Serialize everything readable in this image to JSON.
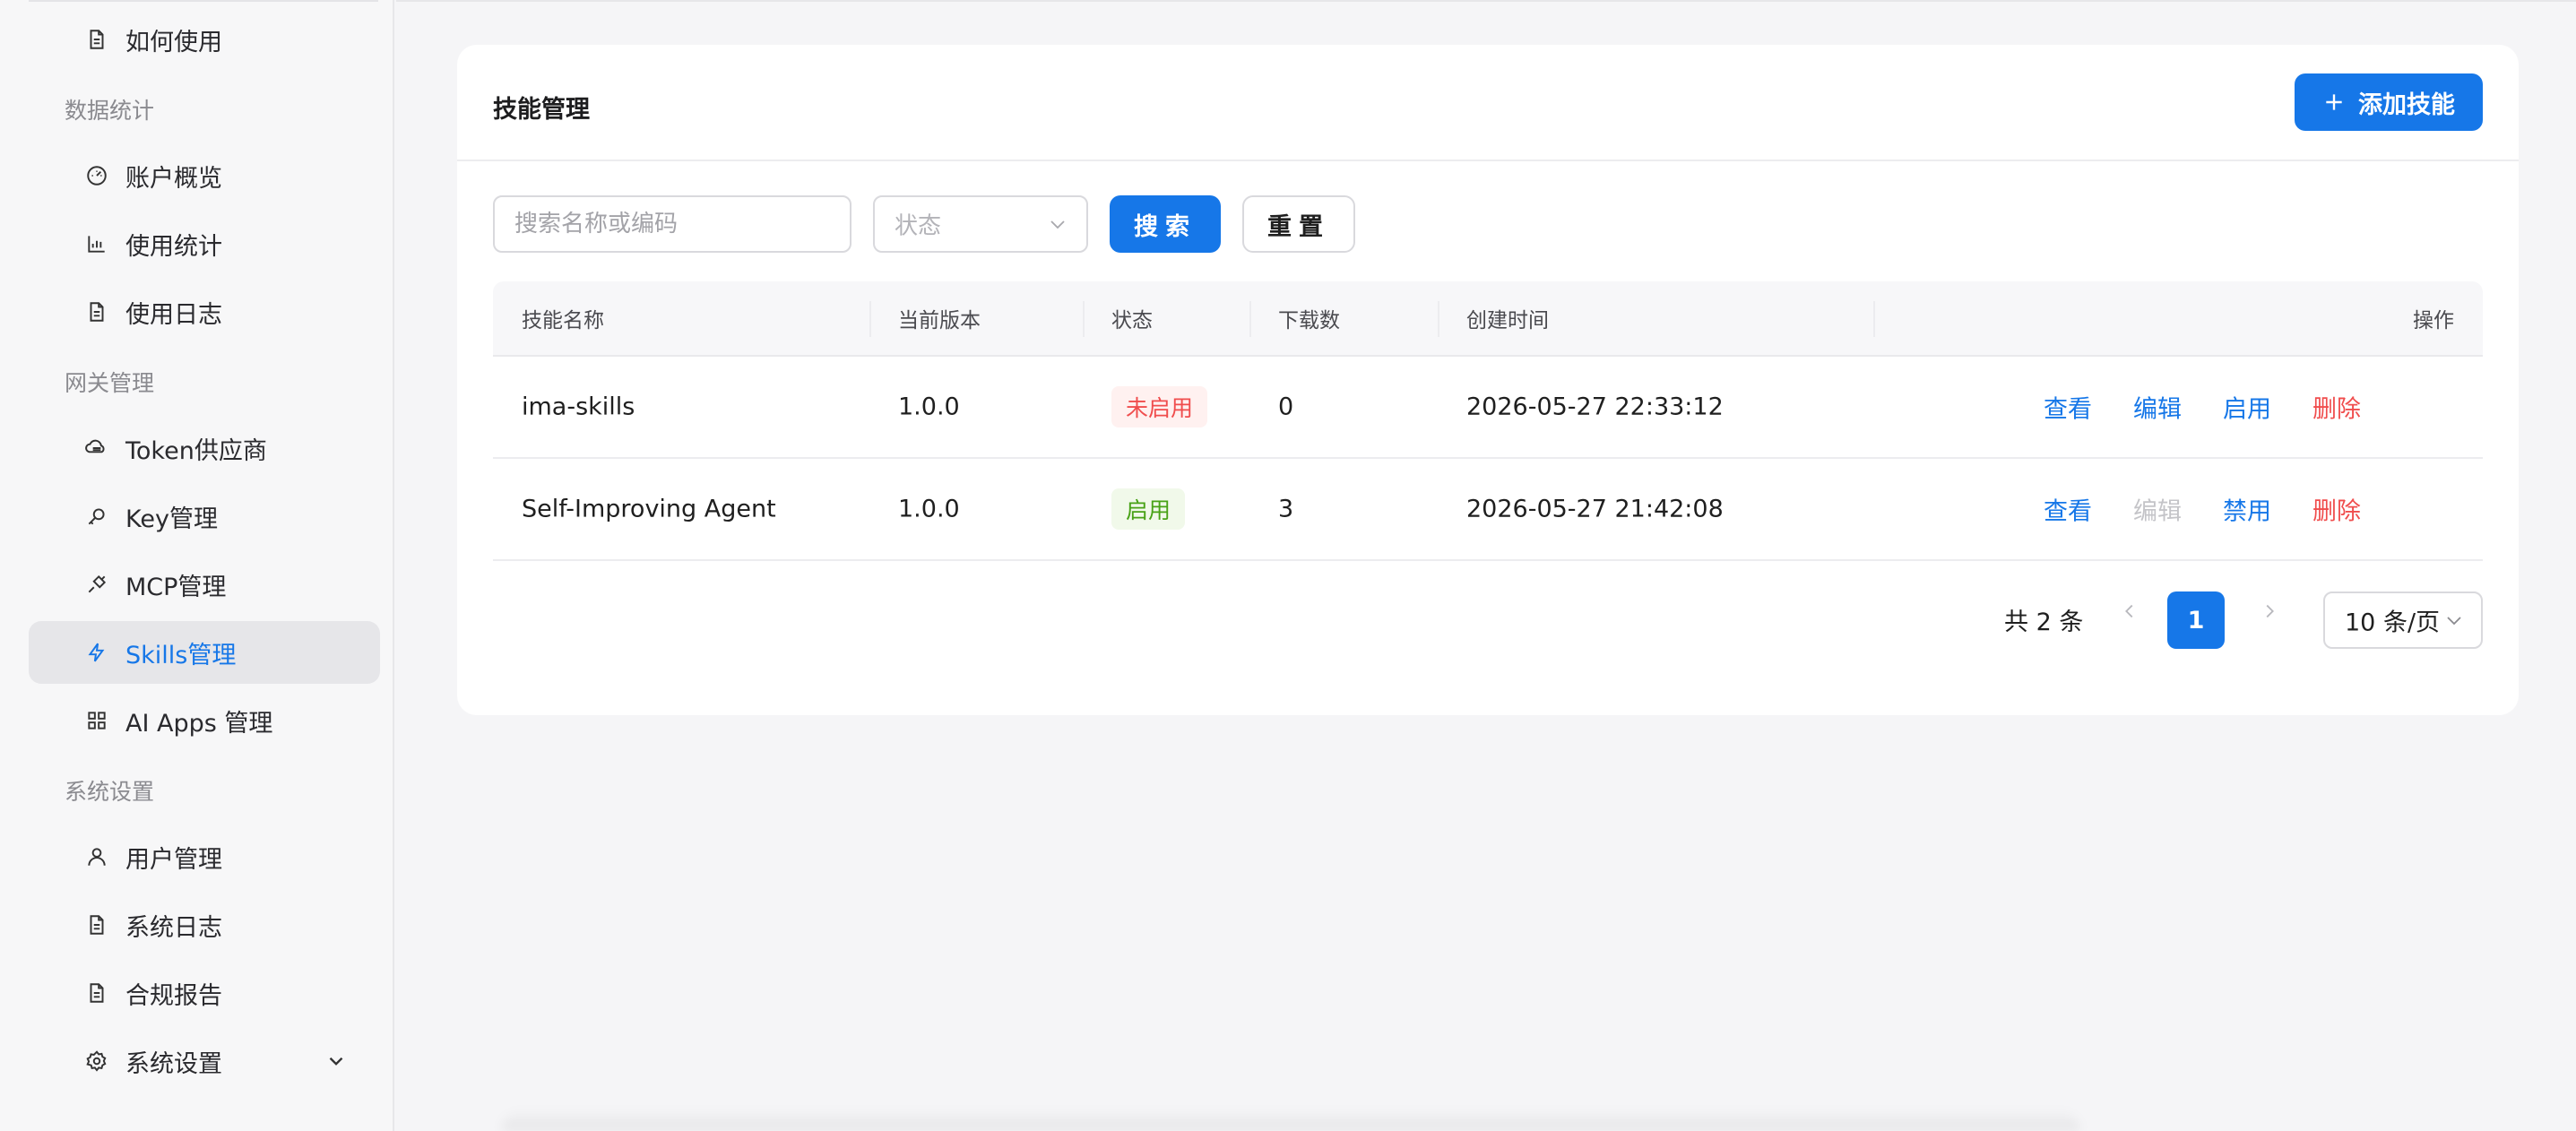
{
  "sidebar": {
    "top_item": {
      "label": "如何使用",
      "icon": "document-icon"
    },
    "groups": [
      {
        "title": "数据统计",
        "items": [
          {
            "label": "账户概览",
            "icon": "dashboard-icon"
          },
          {
            "label": "使用统计",
            "icon": "bar-chart-icon"
          },
          {
            "label": "使用日志",
            "icon": "document-icon"
          }
        ]
      },
      {
        "title": "网关管理",
        "items": [
          {
            "label": "Token供应商",
            "icon": "cloud-icon"
          },
          {
            "label": "Key管理",
            "icon": "key-icon"
          },
          {
            "label": "MCP管理",
            "icon": "plug-icon"
          },
          {
            "label": "Skills管理",
            "icon": "lightning-icon",
            "active": true
          },
          {
            "label": "AI Apps 管理",
            "icon": "apps-grid-icon"
          }
        ]
      },
      {
        "title": "系统设置",
        "items": [
          {
            "label": "用户管理",
            "icon": "user-icon"
          },
          {
            "label": "系统日志",
            "icon": "document-icon"
          },
          {
            "label": "合规报告",
            "icon": "document-icon"
          },
          {
            "label": "系统设置",
            "icon": "gear-icon",
            "expandable": true
          }
        ]
      }
    ]
  },
  "page": {
    "title": "技能管理",
    "add_button": "添加技能"
  },
  "filters": {
    "search_placeholder": "搜索名称或编码",
    "search_value": "",
    "status_placeholder": "状态",
    "search_button": "搜索",
    "reset_button": "重置"
  },
  "table": {
    "columns": [
      "技能名称",
      "当前版本",
      "状态",
      "下载数",
      "创建时间",
      "操作"
    ],
    "rows": [
      {
        "name": "ima-skills",
        "version": "1.0.0",
        "status": "未启用",
        "status_type": "off",
        "downloads": "0",
        "created": "2026-05-27 22:33:12",
        "actions": [
          "查看",
          "编辑",
          "启用",
          "删除"
        ],
        "edit_disabled": false
      },
      {
        "name": "Self-Improving Agent",
        "version": "1.0.0",
        "status": "启用",
        "status_type": "on",
        "downloads": "3",
        "created": "2026-05-27 21:42:08",
        "actions": [
          "查看",
          "编辑",
          "禁用",
          "删除"
        ],
        "edit_disabled": true
      }
    ]
  },
  "pagination": {
    "total_text": "共 2 条",
    "current_page": "1",
    "page_size": "10 条/页"
  },
  "colors": {
    "primary": "#1677e8",
    "danger": "#f04d4d",
    "success": "#49a217",
    "disabled": "#c4c4c8"
  }
}
